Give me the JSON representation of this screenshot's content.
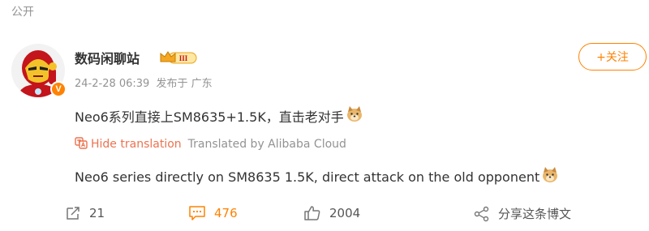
{
  "post": {
    "visibility": "公开",
    "author": {
      "name": "数码闲聊站",
      "vip_level": "III",
      "verified_mark": "V"
    },
    "meta": {
      "timestamp": "24-2-28 06:39",
      "posted_from": "发布于 广东"
    },
    "follow_label": "+关注",
    "content": {
      "text": "Neo6系列直接上SM8635+1.5K，直击老对手",
      "emoji": "doge-emoji"
    },
    "translation": {
      "hide_label": "Hide translation",
      "translated_by": "Translated by Alibaba Cloud",
      "text": "Neo6 series directly on SM8635 1.5K, direct attack on the old opponent"
    },
    "actions": {
      "reposts": "21",
      "comments": "476",
      "likes": "2004",
      "share_label": "分享这条博文"
    }
  },
  "colors": {
    "accent": "#ff8200",
    "translation_accent": "#eb7350",
    "muted": "#939393",
    "text": "#333333"
  },
  "icons": [
    "avatar-iron-man",
    "verified-v-badge",
    "vip-crown-badge",
    "translate-icon",
    "repost-icon",
    "comment-icon",
    "like-icon",
    "share-icon",
    "doge-emoji"
  ]
}
